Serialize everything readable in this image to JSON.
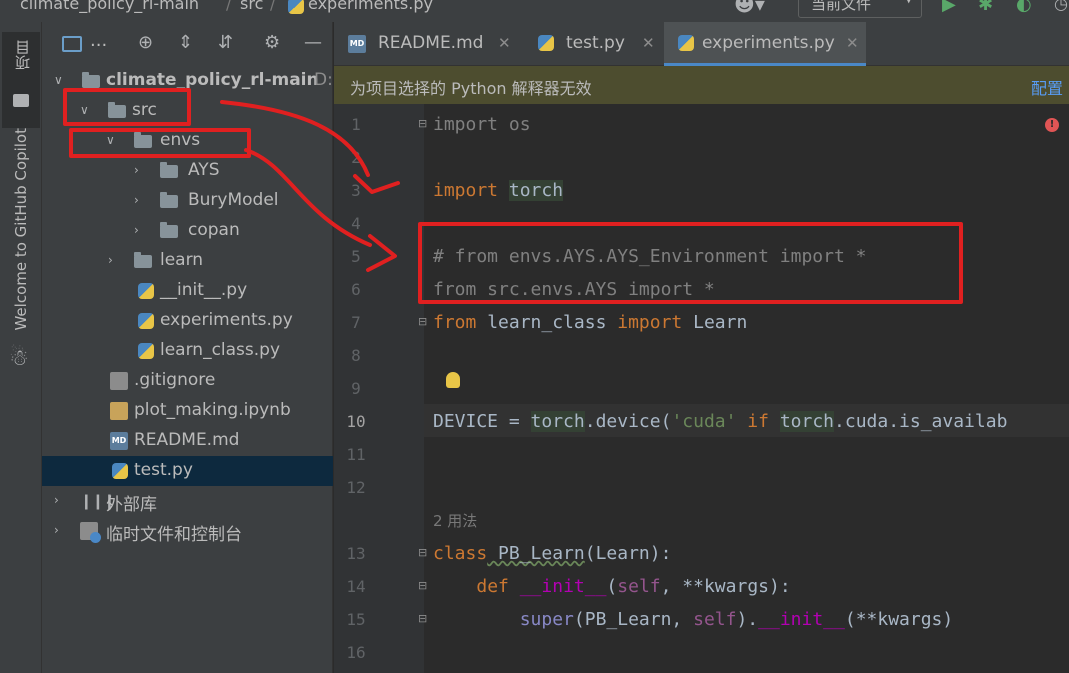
{
  "topbar": {
    "project": "climate_policy_rl-main",
    "folder": "src",
    "file": "experiments.py",
    "run_config": "当前文件"
  },
  "strip": {
    "project_label": "项目",
    "copilot_label": "Welcome to GitHub Copilot"
  },
  "tree": {
    "root_name": "climate_policy_rl-main",
    "root_path": "D:",
    "src": "src",
    "envs": "envs",
    "ays": "AYS",
    "burymodel": "BuryModel",
    "copan": "copan",
    "learn": "learn",
    "init": "__init__.py",
    "experiments": "experiments.py",
    "learn_class": "learn_class.py",
    "gitignore": ".gitignore",
    "plot_making": "plot_making.ipynb",
    "readme": "README.md",
    "test": "test.py",
    "external": "外部库",
    "scratches": "临时文件和控制台"
  },
  "tabs": [
    {
      "label": "README.md",
      "icon": "markdown-file-icon"
    },
    {
      "label": "test.py",
      "icon": "python-file-icon"
    },
    {
      "label": "experiments.py",
      "icon": "python-file-icon",
      "active": true
    }
  ],
  "banner": {
    "message": "为项目选择的 Python 解释器无效",
    "action": "配置"
  },
  "editor": {
    "line_numbers": [
      "1",
      "2",
      "3",
      "4",
      "5",
      "6",
      "7",
      "8",
      "9",
      "10",
      "11",
      "12",
      "13",
      "14",
      "15",
      "16"
    ],
    "usages": "2 用法",
    "code": {
      "l1_kw": "import",
      "l1_mod": " os",
      "l3_kw": "import",
      "l3_mod": "torch",
      "l5_comment": "# from envs.AYS.AYS_Environment import *",
      "l6_comment": "from src.envs.AYS import *",
      "l7_from": "from",
      "l7_mod": " learn_class ",
      "l7_import": "import",
      "l7_name": " Learn",
      "l10_a": "DEVICE = ",
      "l10_torch": "torch",
      "l10_b": ".device(",
      "l10_str": "'cuda'",
      "l10_if": " if ",
      "l10_torch2": "torch",
      "l10_c": ".cuda.is_availab",
      "l13_kw": "class",
      "l13_name": " PB_Learn",
      "l13_rest": "(Learn):",
      "l14_kw": "def",
      "l14_sp": " ",
      "l14_name": "__init__",
      "l14_a": "(",
      "l14_self": "self",
      "l14_b": ", **kwargs):",
      "l15_super": "super",
      "l15_a": "(PB_Learn, ",
      "l15_self": "self",
      "l15_b": ").",
      "l15_init": "__init__",
      "l15_c": "(**kwargs)"
    }
  },
  "colors": {
    "annotation": "#e02020",
    "selection": "#0d293e",
    "banner": "#4d4d2f"
  }
}
